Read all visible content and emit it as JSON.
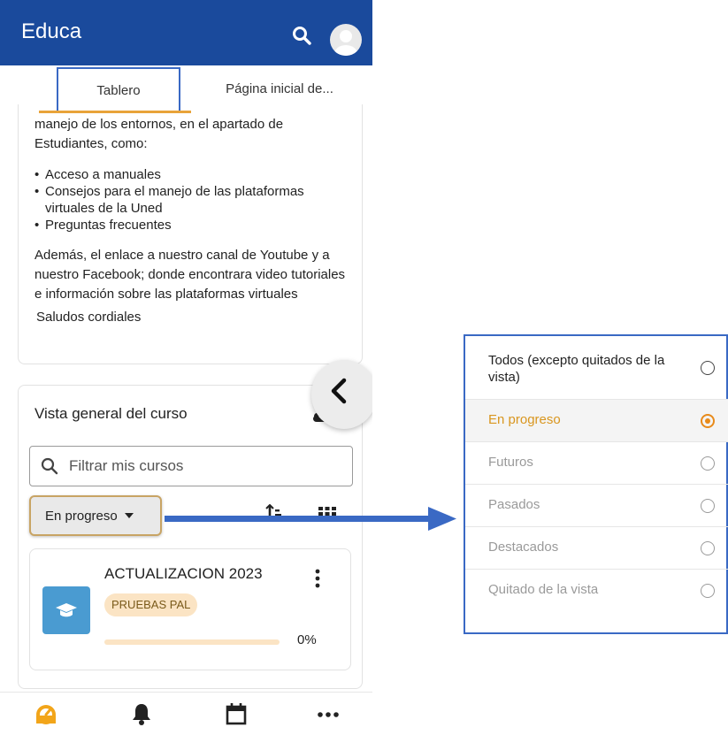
{
  "app": {
    "title": "Educa"
  },
  "tabs": [
    {
      "label": "Tablero"
    },
    {
      "label": "Página inicial de..."
    }
  ],
  "info": {
    "intro": "manejo de los entornos, en el apartado de Estudiantes, como:",
    "list": [
      "Acceso a manuales",
      "Consejos para el manejo de las plataformas virtuales de la Uned",
      "Preguntas frecuentes"
    ],
    "paragraph": "Además, el enlace a nuestro canal de Youtube y a nuestro Facebook; donde encontrara video tutoriales e información sobre las plataformas virtuales",
    "greeting": "Saludos cordiales"
  },
  "overview": {
    "title": "Vista general del curso",
    "filter_placeholder": "Filtrar mis cursos",
    "state_label": "En progreso",
    "course": {
      "name": "ACTUALIZACION 2023",
      "category": "PRUEBAS PAL",
      "progress": "0%"
    }
  },
  "menu": {
    "items": [
      {
        "label": "Todos (excepto quitados de la vista)"
      },
      {
        "label": "En progreso"
      },
      {
        "label": "Futuros"
      },
      {
        "label": "Pasados"
      },
      {
        "label": "Destacados"
      },
      {
        "label": "Quitado de la vista"
      }
    ],
    "selected": "En progreso"
  },
  "bottom_nav": [
    "dashboard-icon",
    "notifications-icon",
    "calendar-icon",
    "more-icon"
  ],
  "colors": {
    "appbar": "#1a4a9c",
    "accent": "#e8a33a",
    "highlight_border": "#3a69c4",
    "arrow": "#3a69c4"
  }
}
